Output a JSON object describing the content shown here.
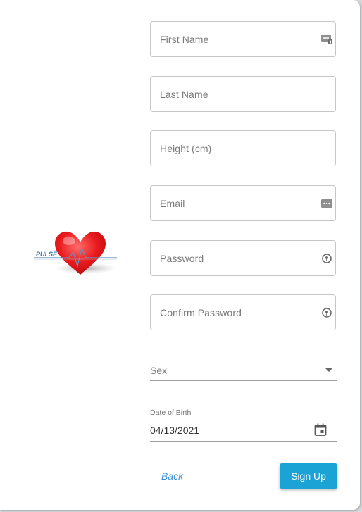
{
  "logo": {
    "text": "PULSE"
  },
  "form": {
    "first_name_placeholder": "First Name",
    "last_name_placeholder": "Last Name",
    "height_placeholder": "Height (cm)",
    "email_placeholder": "Email",
    "password_placeholder": "Password",
    "confirm_password_placeholder": "Confirm Password",
    "sex_placeholder": "Sex",
    "dob_label": "Date of Birth",
    "dob_value": "04/13/2021"
  },
  "actions": {
    "back_label": "Back",
    "signup_label": "Sign Up"
  },
  "colors": {
    "accent": "#1ba3d6",
    "link": "#3b8fd3",
    "heart": "#e8191c"
  }
}
